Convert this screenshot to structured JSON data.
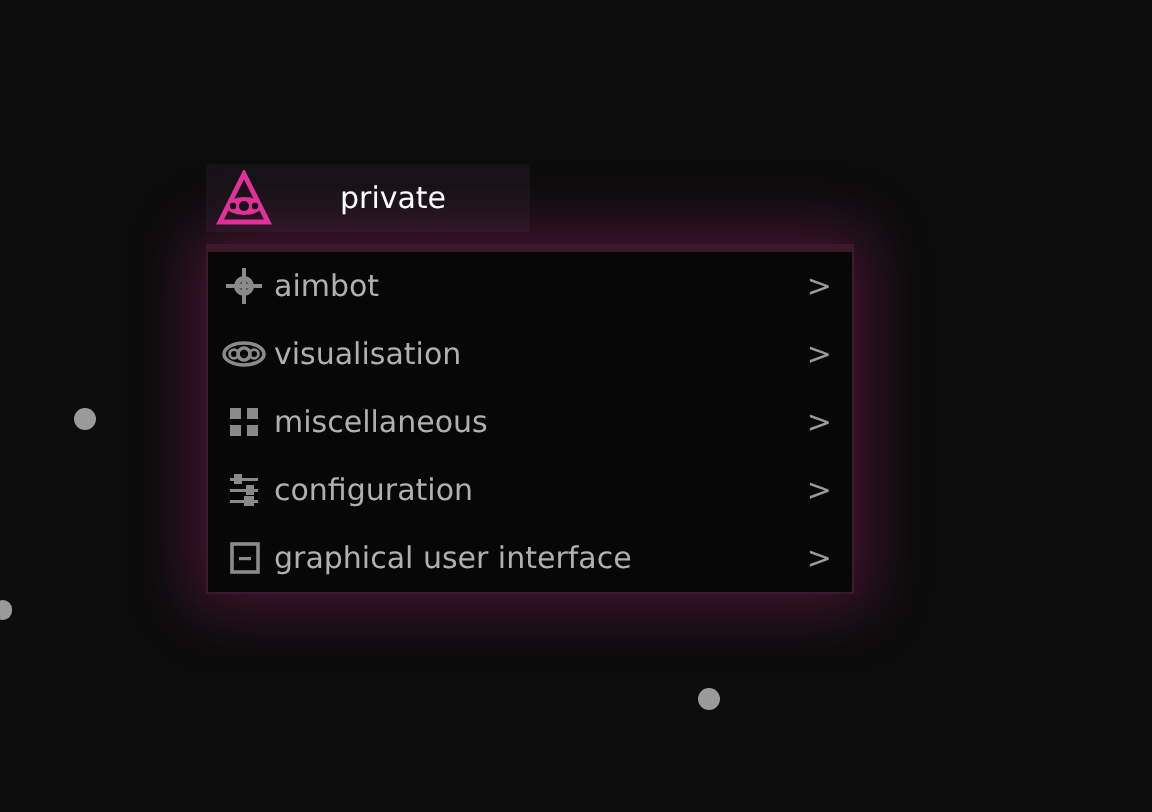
{
  "header": {
    "title": "private"
  },
  "menu": [
    {
      "kind": "crosshair",
      "label": "aimbot",
      "arrow": ">"
    },
    {
      "kind": "eye",
      "label": "visualisation",
      "arrow": ">"
    },
    {
      "kind": "grid",
      "label": "miscellaneous",
      "arrow": ">"
    },
    {
      "kind": "sliders",
      "label": "configuration",
      "arrow": ">"
    },
    {
      "kind": "window",
      "label": "graphical user interface",
      "arrow": ">"
    }
  ]
}
